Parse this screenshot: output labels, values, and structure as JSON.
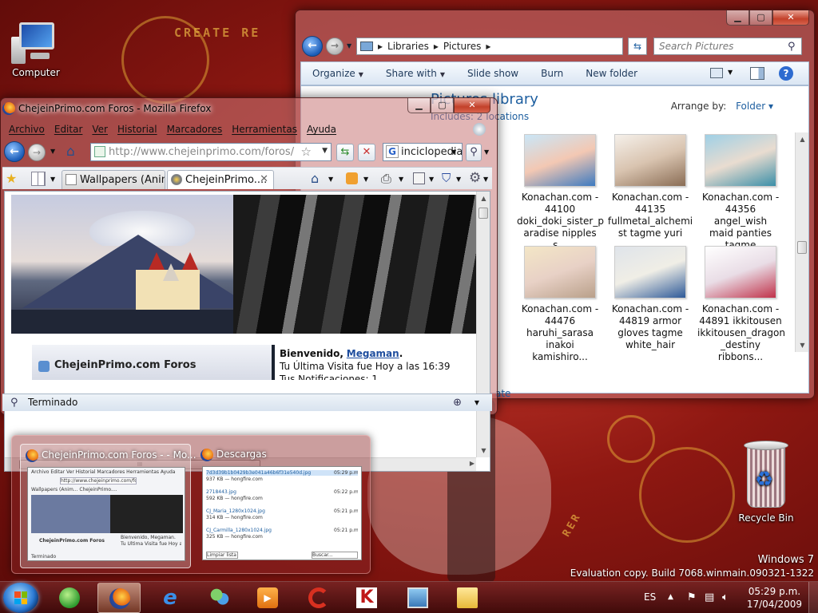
{
  "desktop": {
    "computer_label": "Computer",
    "recycle_bin_label": "Recycle Bin",
    "wallpaper_texts": [
      "CREATE RE",
      "RER"
    ]
  },
  "explorer": {
    "breadcrumb": [
      "Libraries",
      "Pictures"
    ],
    "search_placeholder": "Search Pictures",
    "toolbar": [
      "Organize",
      "Share with",
      "Slide show",
      "Burn",
      "New folder"
    ],
    "toolbar_dropdowns": [
      "Organize",
      "Share with"
    ],
    "library_title": "Pictures library",
    "library_subtitle": "Includes: 2 locations",
    "arrange_label": "Arrange by:",
    "arrange_value": "Folder",
    "partial_link": "ate",
    "thumbnails": [
      {
        "lines": [
          "Konachan.com -",
          "44100",
          "doki_doki_sister_p",
          "aradise nipples s..."
        ]
      },
      {
        "lines": [
          "Konachan.com -",
          "44135",
          "fullmetal_alchemi",
          "st tagme yuri"
        ]
      },
      {
        "lines": [
          "Konachan.com -",
          "44356 angel_wish",
          "maid panties",
          "tagme takazuhir..."
        ]
      },
      {
        "lines": [
          "Konachan.com -",
          "44476",
          "haruhi_sarasa",
          "inakoi kamishiro..."
        ]
      },
      {
        "lines": [
          "Konachan.com -",
          "44819 armor",
          "gloves tagme",
          "white_hair"
        ]
      },
      {
        "lines": [
          "Konachan.com -",
          "44891 ikkitousen",
          "ikkitousen_dragon",
          "_destiny ribbons..."
        ]
      }
    ],
    "colors": {
      "accent": "#1e5fa0"
    }
  },
  "firefox": {
    "title": "ChejeinPrimo.com Foros - Mozilla Firefox",
    "menu": [
      "Archivo",
      "Editar",
      "Ver",
      "Historial",
      "Marcadores",
      "Herramientas",
      "Ayuda"
    ],
    "url": "http://www.chejeinprimo.com/foros/",
    "search_value": "inciclopedia",
    "tabs": [
      "Wallpapers (Anim...",
      "ChejeinPrimo...."
    ],
    "page": {
      "forum_title": "ChejeinPrimo.com Foros",
      "welcome": "Bienvenido,",
      "username": "Megaman",
      "last_visit": "Tu Última Visita fue Hoy a las 16:39",
      "notifications": "Tus Notificaciones: 1"
    },
    "scroll_grip": "III",
    "status": "Terminado"
  },
  "thumbnails_popup": {
    "cards": [
      {
        "title": "ChejeinPrimo.com Foros - - Mo...",
        "mini_menu": "Archivo  Editar  Ver  Historial  Marcadores  Herramientas  Ayuda",
        "mini_url": "http://www.chejeinprimo.com/foros/",
        "mini_tabs": "Wallpapers (Anim...   ChejeinPrimo....",
        "mini_forum": "ChejeinPrimo.com Foros",
        "mini_welcome": "Bienvenido, Megaman.",
        "mini_visit": "Tu Última Visita fue Hoy a las 16:39",
        "mini_status": "Terminado"
      },
      {
        "title": "Descargas",
        "downloads": [
          {
            "name": "7d3d39b1b0429b3e041a46b6f31e540d.jpg",
            "info": "937 KB — hongfire.com",
            "time": "05:29 p.m."
          },
          {
            "name": "2718443.jpg",
            "info": "592 KB — hongfire.com",
            "time": "05:22 p.m."
          },
          {
            "name": "CJ_Maria_1280x1024.jpg",
            "info": "314 KB — hongfire.com",
            "time": "05:21 p.m."
          },
          {
            "name": "CJ_Carmilla_1280x1024.jpg",
            "info": "325 KB — hongfire.com",
            "time": "05:21 p.m."
          }
        ],
        "clear_label": "Limpiar lista",
        "search_label": "Buscar..."
      }
    ]
  },
  "watermark": {
    "line1": "Windows 7",
    "line2": "Evaluation copy. Build 7068.winmain.090321-1322"
  },
  "taskbar": {
    "pinned": [
      "windows-media-center",
      "firefox",
      "internet-explorer",
      "windows-live-messenger",
      "windows-media-player",
      "ccleaner",
      "kaspersky",
      "pictures",
      "windows-explorer"
    ],
    "active_index": 1,
    "tray": {
      "language": "ES",
      "time": "05:29 p.m.",
      "date": "17/04/2009"
    }
  }
}
